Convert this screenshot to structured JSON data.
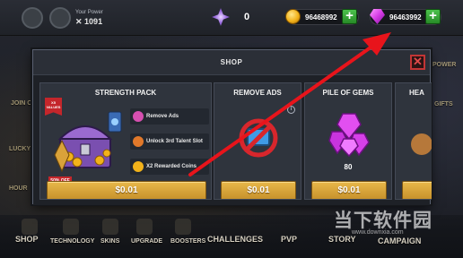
{
  "top_bar": {
    "power_label": "Your Power",
    "power_value": "1091",
    "energy_value": "0",
    "coins_value": "96468992",
    "gems_value": "96463992",
    "plus_label": "+"
  },
  "background": {
    "side_labels": [
      "JOIN OUR",
      "LUCKY",
      "HOUR",
      "POWER",
      "GIFTS"
    ]
  },
  "shop": {
    "title": "SHOP",
    "close_label": "✕",
    "strength_pack": {
      "title": "STRENGTH PACK",
      "ribbon": "X5 VALUES",
      "discount": "50% OFF",
      "features": [
        "Remove Ads",
        "Unlock 3rd Talent Slot",
        "X2 Rewarded Coins"
      ],
      "price": "$0.01"
    },
    "remove_ads": {
      "title": "REMOVE ADS",
      "info": "i",
      "price": "$0.01"
    },
    "pile_of_gems": {
      "title": "PILE OF GEMS",
      "count": "80",
      "price": "$0.01"
    },
    "partial_card": {
      "title": "HEA"
    }
  },
  "bottom_nav": {
    "items": [
      "SHOP",
      "TECHNOLOGY",
      "SKINS",
      "UPGRADE",
      "BOOSTERS",
      "CHALLENGES",
      "PVP",
      "STORY",
      "CAMPAIGN"
    ]
  },
  "watermark": {
    "text": "当下软件园",
    "url": "www.downxia.com"
  },
  "colors": {
    "accent_gold": "#e8b84a",
    "close_red": "#c23535",
    "arrow_red": "#e8141b",
    "gem_purple": "#d43be3",
    "plus_green": "#4cc24c"
  }
}
